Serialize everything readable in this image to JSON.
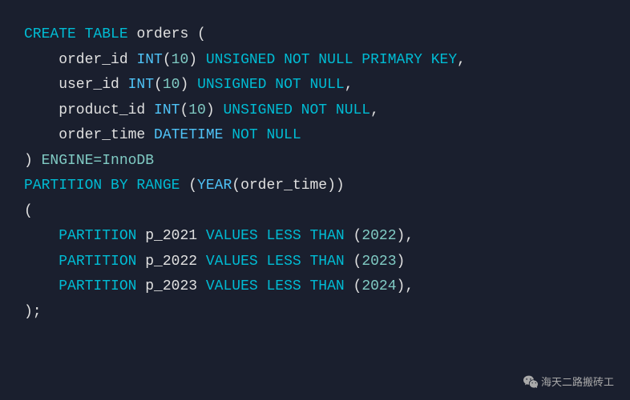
{
  "background": "#1a1f2e",
  "code": {
    "lines": [
      {
        "id": "line1",
        "parts": [
          {
            "text": "CREATE TABLE ",
            "style": "kw-cyan"
          },
          {
            "text": "orders",
            "style": "kw-white"
          },
          {
            "text": " (",
            "style": "kw-white"
          }
        ]
      },
      {
        "id": "line2",
        "parts": [
          {
            "text": "    order_id ",
            "style": "kw-white"
          },
          {
            "text": "INT",
            "style": "kw-blue"
          },
          {
            "text": "(",
            "style": "kw-white"
          },
          {
            "text": "10",
            "style": "kw-green"
          },
          {
            "text": ") ",
            "style": "kw-white"
          },
          {
            "text": "UNSIGNED NOT NULL PRIMARY KEY",
            "style": "kw-cyan"
          },
          {
            "text": ",",
            "style": "kw-white"
          }
        ]
      },
      {
        "id": "line3",
        "parts": [
          {
            "text": "    user_id ",
            "style": "kw-white"
          },
          {
            "text": "INT",
            "style": "kw-blue"
          },
          {
            "text": "(",
            "style": "kw-white"
          },
          {
            "text": "10",
            "style": "kw-green"
          },
          {
            "text": ") ",
            "style": "kw-white"
          },
          {
            "text": "UNSIGNED NOT NULL",
            "style": "kw-cyan"
          },
          {
            "text": ",",
            "style": "kw-white"
          }
        ]
      },
      {
        "id": "line4",
        "parts": [
          {
            "text": "    product_id ",
            "style": "kw-white"
          },
          {
            "text": "INT",
            "style": "kw-blue"
          },
          {
            "text": "(",
            "style": "kw-white"
          },
          {
            "text": "10",
            "style": "kw-green"
          },
          {
            "text": ") ",
            "style": "kw-white"
          },
          {
            "text": "UNSIGNED NOT NULL",
            "style": "kw-cyan"
          },
          {
            "text": ",",
            "style": "kw-white"
          }
        ]
      },
      {
        "id": "line5",
        "parts": [
          {
            "text": "    order_time ",
            "style": "kw-white"
          },
          {
            "text": "DATETIME ",
            "style": "kw-blue"
          },
          {
            "text": "NOT NULL",
            "style": "kw-cyan"
          }
        ]
      },
      {
        "id": "line6",
        "parts": [
          {
            "text": ") ",
            "style": "kw-white"
          },
          {
            "text": "ENGINE=InnoDB",
            "style": "kw-green"
          }
        ]
      },
      {
        "id": "line7",
        "parts": [
          {
            "text": "PARTITION BY RANGE ",
            "style": "kw-cyan"
          },
          {
            "text": "(",
            "style": "kw-white"
          },
          {
            "text": "YEAR",
            "style": "kw-blue"
          },
          {
            "text": "(",
            "style": "kw-white"
          },
          {
            "text": "order_time",
            "style": "kw-white"
          },
          {
            "text": "))",
            "style": "kw-white"
          }
        ]
      },
      {
        "id": "line8",
        "parts": [
          {
            "text": "(",
            "style": "kw-white"
          }
        ]
      },
      {
        "id": "line9",
        "parts": [
          {
            "text": "    ",
            "style": "kw-white"
          },
          {
            "text": "PARTITION ",
            "style": "kw-cyan"
          },
          {
            "text": "p_2021 ",
            "style": "kw-white"
          },
          {
            "text": "VALUES LESS THAN ",
            "style": "kw-cyan"
          },
          {
            "text": "(",
            "style": "kw-white"
          },
          {
            "text": "2022",
            "style": "kw-green"
          },
          {
            "text": "),",
            "style": "kw-white"
          }
        ]
      },
      {
        "id": "line10",
        "parts": [
          {
            "text": "    ",
            "style": "kw-white"
          },
          {
            "text": "PARTITION ",
            "style": "kw-cyan"
          },
          {
            "text": "p_2022 ",
            "style": "kw-white"
          },
          {
            "text": "VALUES LESS THAN ",
            "style": "kw-cyan"
          },
          {
            "text": "(",
            "style": "kw-white"
          },
          {
            "text": "2023",
            "style": "kw-green"
          },
          {
            "text": ")",
            "style": "kw-white"
          }
        ]
      },
      {
        "id": "line11",
        "parts": [
          {
            "text": "    ",
            "style": "kw-white"
          },
          {
            "text": "PARTITION ",
            "style": "kw-cyan"
          },
          {
            "text": "p_2023 ",
            "style": "kw-white"
          },
          {
            "text": "VALUES LESS THAN ",
            "style": "kw-cyan"
          },
          {
            "text": "(",
            "style": "kw-white"
          },
          {
            "text": "2024",
            "style": "kw-green"
          },
          {
            "text": "),",
            "style": "kw-white"
          }
        ]
      },
      {
        "id": "line12",
        "parts": [
          {
            "text": ");",
            "style": "kw-white"
          }
        ]
      }
    ]
  },
  "watermark": {
    "icon": "wechat",
    "text": "海天二路搬砖工"
  }
}
